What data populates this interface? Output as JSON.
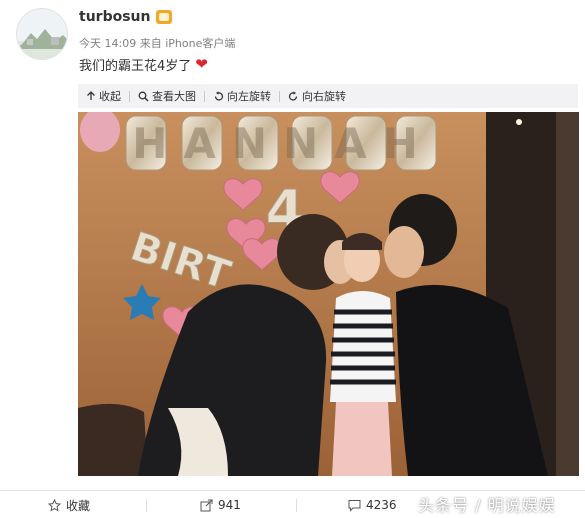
{
  "post": {
    "username": "turbosun",
    "time": "今天 14:09",
    "source_prefix": "来自",
    "source": "iPhone客户端",
    "text": "我们的霸王花4岁了",
    "heart_icon": "heart-icon"
  },
  "toolbar": {
    "collapse_label": "收起",
    "view_large_label": "查看大图",
    "rotate_left_label": "向左旋转",
    "rotate_right_label": "向右旋转"
  },
  "photo": {
    "balloon_letters_top": "HANNAH",
    "balloon_number": "4",
    "balloon_letters_side": "BIRT"
  },
  "footer": {
    "favorite_label": "收藏",
    "share_count": "941",
    "comment_count": "4236"
  },
  "watermark": "头条号 / 明说娱娱",
  "colors": {
    "toolbar_bg": "#f2f2f5",
    "heart": "#d9282f",
    "vip_badge": "#f5a623",
    "wall": "#b77a4a"
  }
}
